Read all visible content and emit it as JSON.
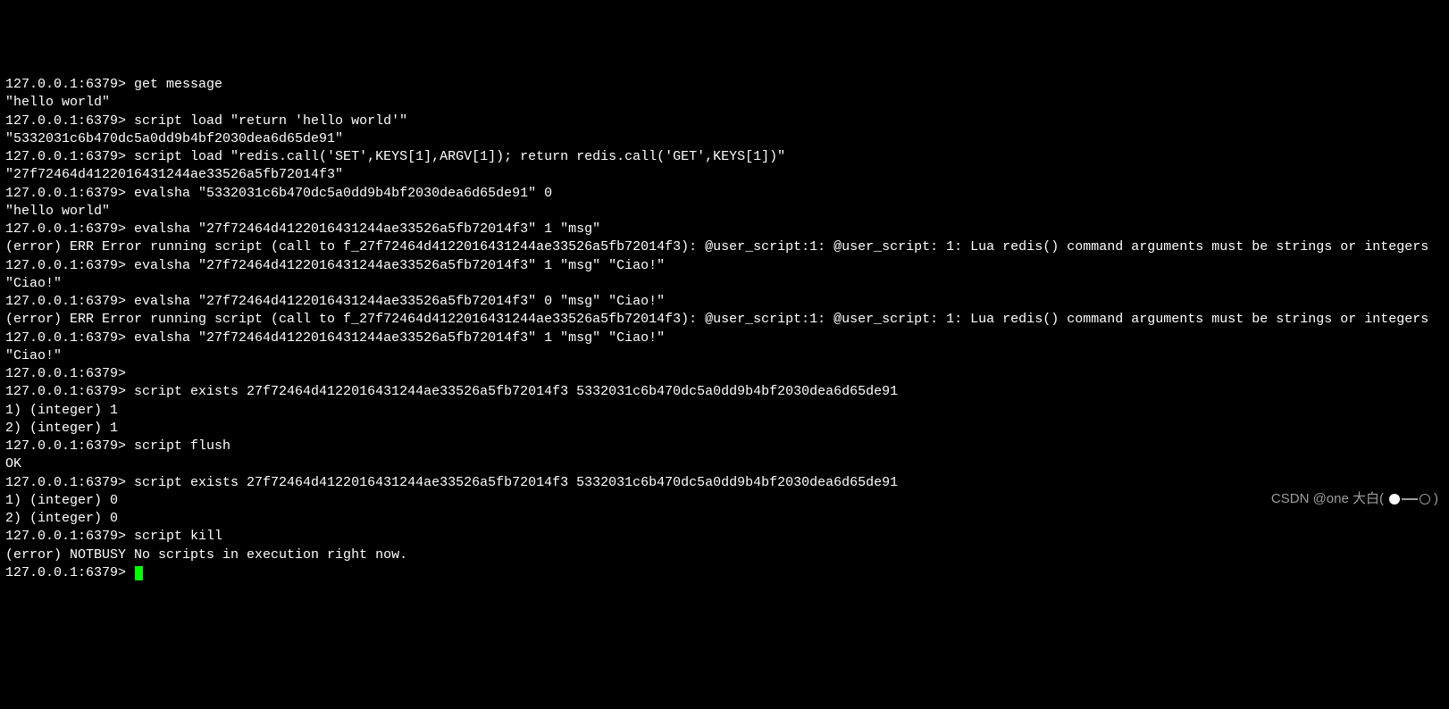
{
  "prompt": "127.0.0.1:6379> ",
  "lines": [
    {
      "prompt": true,
      "text": "get message"
    },
    {
      "prompt": false,
      "text": "\"hello world\""
    },
    {
      "prompt": true,
      "text": "script load \"return 'hello world'\""
    },
    {
      "prompt": false,
      "text": "\"5332031c6b470dc5a0dd9b4bf2030dea6d65de91\""
    },
    {
      "prompt": true,
      "text": "script load \"redis.call('SET',KEYS[1],ARGV[1]); return redis.call('GET',KEYS[1])\""
    },
    {
      "prompt": false,
      "text": "\"27f72464d4122016431244ae33526a5fb72014f3\""
    },
    {
      "prompt": true,
      "text": "evalsha \"5332031c6b470dc5a0dd9b4bf2030dea6d65de91\" 0"
    },
    {
      "prompt": false,
      "text": "\"hello world\""
    },
    {
      "prompt": true,
      "text": "evalsha \"27f72464d4122016431244ae33526a5fb72014f3\" 1 \"msg\""
    },
    {
      "prompt": false,
      "text": "(error) ERR Error running script (call to f_27f72464d4122016431244ae33526a5fb72014f3): @user_script:1: @user_script: 1: Lua redis() command arguments must be strings or integers"
    },
    {
      "prompt": true,
      "text": "evalsha \"27f72464d4122016431244ae33526a5fb72014f3\" 1 \"msg\" \"Ciao!\""
    },
    {
      "prompt": false,
      "text": "\"Ciao!\""
    },
    {
      "prompt": true,
      "text": "evalsha \"27f72464d4122016431244ae33526a5fb72014f3\" 0 \"msg\" \"Ciao!\""
    },
    {
      "prompt": false,
      "text": "(error) ERR Error running script (call to f_27f72464d4122016431244ae33526a5fb72014f3): @user_script:1: @user_script: 1: Lua redis() command arguments must be strings or integers"
    },
    {
      "prompt": true,
      "text": "evalsha \"27f72464d4122016431244ae33526a5fb72014f3\" 1 \"msg\" \"Ciao!\""
    },
    {
      "prompt": false,
      "text": "\"Ciao!\""
    },
    {
      "prompt": true,
      "text": ""
    },
    {
      "prompt": true,
      "text": "script exists 27f72464d4122016431244ae33526a5fb72014f3 5332031c6b470dc5a0dd9b4bf2030dea6d65de91"
    },
    {
      "prompt": false,
      "text": "1) (integer) 1"
    },
    {
      "prompt": false,
      "text": "2) (integer) 1"
    },
    {
      "prompt": true,
      "text": "script flush"
    },
    {
      "prompt": false,
      "text": "OK"
    },
    {
      "prompt": true,
      "text": "script exists 27f72464d4122016431244ae33526a5fb72014f3 5332031c6b470dc5a0dd9b4bf2030dea6d65de91"
    },
    {
      "prompt": false,
      "text": "1) (integer) 0"
    },
    {
      "prompt": false,
      "text": "2) (integer) 0"
    },
    {
      "prompt": true,
      "text": "script kill"
    },
    {
      "prompt": false,
      "text": "(error) NOTBUSY No scripts in execution right now."
    },
    {
      "prompt": true,
      "text": "",
      "cursor": true
    }
  ],
  "watermark": "CSDN @one 大白("
}
